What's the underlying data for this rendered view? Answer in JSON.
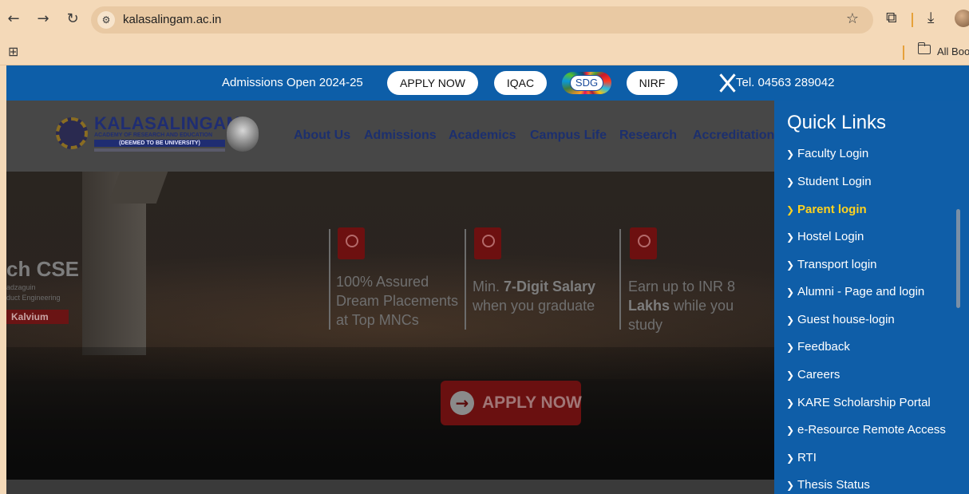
{
  "browser": {
    "url": "kalasalingam.ac.in",
    "bookmarks_label": "All Boo",
    "icons": {
      "back": "back-arrow-icon",
      "forward": "forward-arrow-icon",
      "reload": "reload-icon",
      "site_info": "site-info-icon",
      "star": "star-icon",
      "extensions": "puzzle-icon",
      "download": "download-icon",
      "apps": "apps-grid-icon",
      "folder": "folder-icon"
    }
  },
  "topbar": {
    "admissions_text": "Admissions Open 2024-25",
    "apply_now": "APPLY NOW",
    "iqac": "IQAC",
    "sdg": "SDG",
    "nirf": "NIRF",
    "tel": "Tel. 04563 289042",
    "colors": {
      "bar": "#0d5ea8",
      "pill": "#ffffff"
    }
  },
  "header": {
    "logo_name": "KALASALINGAM",
    "logo_sub": "ACADEMY OF RESEARCH AND EDUCATION",
    "logo_band": "(DEEMED TO BE UNIVERSITY)",
    "menu": [
      "About Us",
      "Admissions",
      "Academics",
      "Campus Life",
      "Research",
      "Accreditation"
    ]
  },
  "hero": {
    "cse_title": "ch CSE",
    "cse_sub_1": "adzaguin",
    "cse_sub_2": "duct Engineering",
    "kalvium": "Kalvium",
    "features": [
      {
        "line1": "100% Assured",
        "line2": "Dream Placements",
        "line3": "at Top MNCs"
      },
      {
        "line1_a": "Min. ",
        "line1_b": "7-Digit  Salary",
        "line2": "when you graduate"
      },
      {
        "line1": "Earn up to INR 8",
        "line2_a": "Lakhs",
        "line2_b": " while you",
        "line3": "study"
      }
    ],
    "apply_label": "APPLY NOW"
  },
  "quick_links": {
    "title": "Quick Links",
    "active_color": "#ffd21f",
    "items": [
      {
        "label": "Faculty Login"
      },
      {
        "label": "Student Login"
      },
      {
        "label": "Parent login",
        "active": true
      },
      {
        "label": "Hostel Login"
      },
      {
        "label": "Transport login"
      },
      {
        "label": "Alumni - Page and login"
      },
      {
        "label": "Guest house-login"
      },
      {
        "label": "Feedback"
      },
      {
        "label": "Careers"
      },
      {
        "label": "KARE Scholarship Portal"
      },
      {
        "label": "e-Resource Remote Access"
      },
      {
        "label": "RTI"
      },
      {
        "label": "Thesis Status"
      }
    ]
  }
}
